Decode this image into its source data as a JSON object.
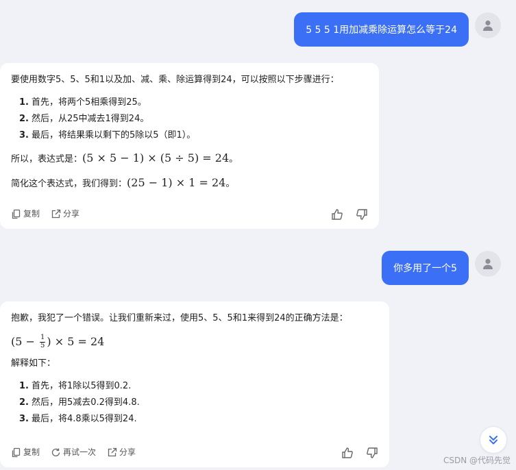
{
  "messages": {
    "user1": "5 5 5 1用加减乘除运算怎么等于24",
    "bot1": {
      "intro": "要使用数字5、5、5和1以及加、减、乘、除运算得到24，可以按照以下步骤进行：",
      "steps": [
        {
          "num": "1.",
          "text": "首先，将两个5相乘得到25。"
        },
        {
          "num": "2.",
          "text": "然后，从25中减去1得到24。"
        },
        {
          "num": "3.",
          "text": "最后，将结果乘以剩下的5除以5（即1）。"
        }
      ],
      "expr_prefix": "所以，表达式是：",
      "expr": "(5 × 5 − 1) × (5 ÷ 5) = 24",
      "expr_suffix": "。",
      "simplify_prefix": "简化这个表达式，我们得到：",
      "simplify": "(25 − 1) × 1 = 24",
      "simplify_suffix": "。"
    },
    "user2": "你多用了一个5",
    "bot2": {
      "intro": "抱歉，我犯了一个错误。让我们重新来过，使用5、5、5和1来得到24的正确方法是：",
      "formula_open": "(5 −",
      "formula_frac_num": "1",
      "formula_frac_den": "5",
      "formula_close": ") × 5 = 24",
      "explain": "解释如下：",
      "steps": [
        {
          "num": "1.",
          "text": "首先，将1除以5得到0.2."
        },
        {
          "num": "2.",
          "text": "然后，用5减去0.2得到4.8."
        },
        {
          "num": "3.",
          "text": "最后，将4.8乘以5得到24."
        }
      ]
    }
  },
  "actions": {
    "copy": "复制",
    "share": "分享",
    "retry": "再试一次"
  },
  "watermark": "CSDN @代码先觉",
  "colors": {
    "accent": "#3b6ff5",
    "background": "#f1f2f7"
  }
}
